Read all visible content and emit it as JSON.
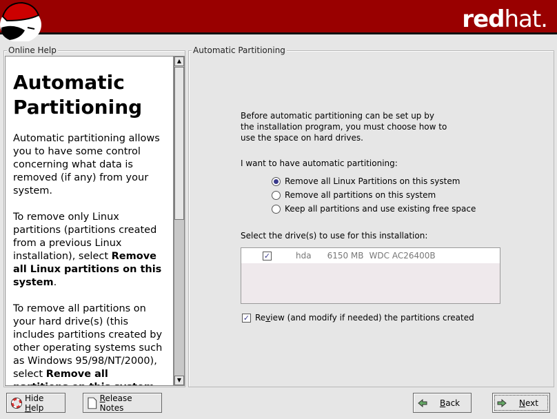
{
  "banner": {
    "brand_bold": "red",
    "brand_light": "hat.",
    "accent": "#990000"
  },
  "help": {
    "frame_label": "Online Help",
    "title": "Automatic Partitioning",
    "p1": "Automatic partitioning allows you to have some control concerning what data is removed (if any) from your system.",
    "p2_a": "To remove only Linux partitions (partitions created from a previous Linux installation), select ",
    "p2_b": "Remove all Linux partitions on this system",
    "p2_c": ".",
    "p3_a": "To remove all partitions on your hard drive(s) (this includes partitions created by other operating systems such as Windows 95/98/NT/2000), select ",
    "p3_b": "Remove all partitions on this system",
    "p3_c": "."
  },
  "main": {
    "frame_label": "Automatic Partitioning",
    "intro": "Before automatic partitioning can be set up by the installation program, you must choose how to use the space on hard drives.",
    "question": "I want to have automatic partitioning:",
    "options": [
      {
        "label": "Remove all Linux Partitions on this system",
        "selected": true
      },
      {
        "label": "Remove all partitions on this system",
        "selected": false
      },
      {
        "label": "Keep all partitions and use existing free space",
        "selected": false
      }
    ],
    "drives_label": "Select the drive(s) to use for this installation:",
    "drives": [
      {
        "checked": true,
        "device": "hda",
        "size": "6150 MB",
        "model": "WDC AC26400B"
      }
    ],
    "review": {
      "pre": "Re",
      "u": "v",
      "post": "iew (and modify if needed) the partitions created",
      "checked": true
    }
  },
  "buttons": {
    "hide_help_pre": "Hide ",
    "hide_help_u": "H",
    "hide_help_post": "elp",
    "release_u": "R",
    "release_post": "elease Notes",
    "back_u": "B",
    "back_post": "ack",
    "next_u": "N",
    "next_post": "ext"
  }
}
